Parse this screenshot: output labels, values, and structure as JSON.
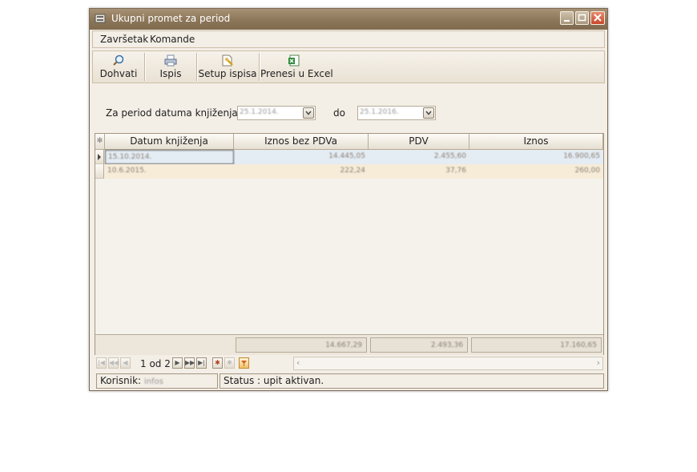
{
  "window": {
    "title": "Ukupni promet za period"
  },
  "menu": {
    "items": [
      "Završetak",
      "Komande"
    ]
  },
  "toolbar": {
    "buttons": [
      {
        "label": "Dohvati",
        "icon": "magnifier-icon"
      },
      {
        "label": "Ispis",
        "icon": "printer-icon"
      },
      {
        "label": "Setup ispisa",
        "icon": "print-setup-icon"
      },
      {
        "label": "Prenesi u Excel",
        "icon": "excel-icon"
      }
    ]
  },
  "filter": {
    "label_from": "Za period datuma knjiženja od",
    "from_value": "25.1.2014.",
    "label_to": "do",
    "to_value": "25.1.2016."
  },
  "grid": {
    "columns": [
      "Datum knjiženja",
      "Iznos bez PDVa",
      "PDV",
      "Iznos"
    ],
    "rows": [
      [
        "15.10.2014.",
        "14.445,05",
        "2.455,60",
        "16.900,65"
      ],
      [
        "10.6.2015.",
        "222,24",
        "37,76",
        "260,00"
      ]
    ],
    "totals": [
      "14.667,29",
      "2.493,36",
      "17.160,65"
    ]
  },
  "navigator": {
    "position": "1 od 2"
  },
  "status": {
    "user_label": "Korisnik:",
    "user_value": "infos",
    "status_text": "Status : upit aktivan."
  }
}
